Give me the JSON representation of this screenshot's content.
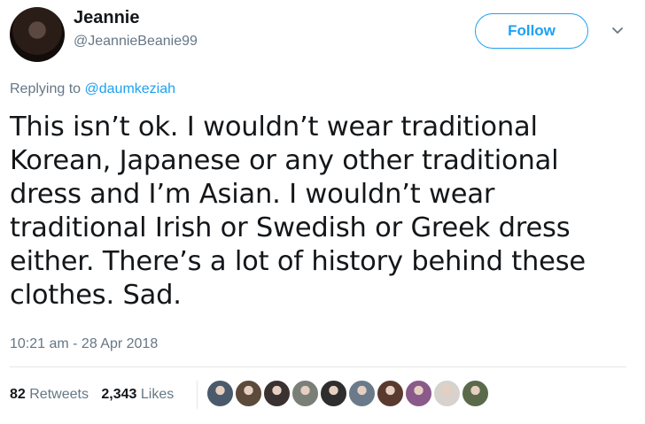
{
  "user": {
    "name": "Jeannie",
    "handle": "@JeannieBeanie99"
  },
  "header": {
    "follow_label": "Follow"
  },
  "reply": {
    "prefix": "Replying to",
    "mention": "@daumkeziah"
  },
  "tweet": {
    "lines": [
      "This isn’t ok. I wouldn’t wear traditional",
      "Korean, Japanese or any other traditional",
      "dress and I’m Asian. I wouldn’t wear",
      "traditional Irish or Swedish or Greek dress",
      "either. There’s a lot of history behind these",
      "clothes. Sad."
    ],
    "timestamp": "10:21 am - 28 Apr 2018"
  },
  "stats": {
    "retweets_count": "82",
    "retweets_label": "Retweets",
    "likes_count": "2,343",
    "likes_label": "Likes"
  },
  "likers": [
    {
      "icon": "avatar-1",
      "color": "#4a5a6a"
    },
    {
      "icon": "avatar-2",
      "color": "#5c4a3a"
    },
    {
      "icon": "avatar-3",
      "color": "#3a3230"
    },
    {
      "icon": "avatar-4",
      "color": "#7a7f78"
    },
    {
      "icon": "avatar-5",
      "color": "#2e2e2e"
    },
    {
      "icon": "avatar-6",
      "color": "#6a7a8a"
    },
    {
      "icon": "avatar-7",
      "color": "#5a3a2e"
    },
    {
      "icon": "avatar-8",
      "color": "#8a5a8a"
    },
    {
      "icon": "avatar-9",
      "color": "#d8d2cc"
    },
    {
      "icon": "avatar-10",
      "color": "#5a6a4a"
    }
  ],
  "colors": {
    "accent": "#1da1f2",
    "secondary_text": "#657786",
    "primary_text": "#14171a"
  }
}
